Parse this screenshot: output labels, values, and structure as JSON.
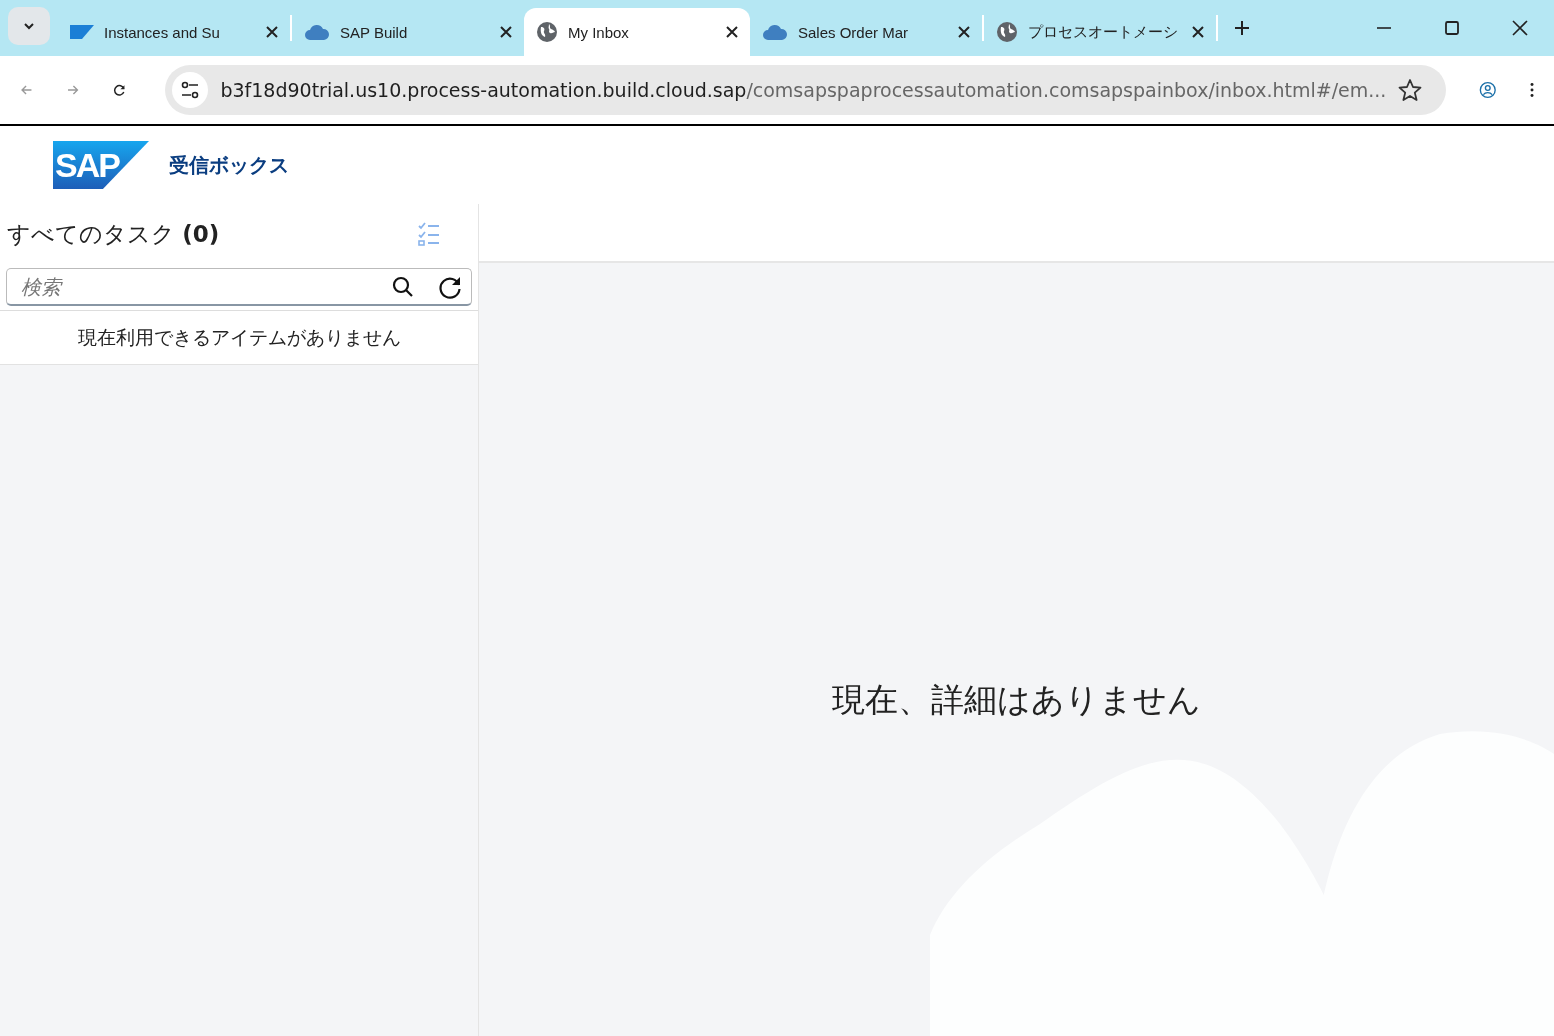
{
  "browser": {
    "tabs": [
      {
        "title": "Instances and Su",
        "kind": "sap",
        "selected": false
      },
      {
        "title": "SAP Build",
        "kind": "cloud",
        "selected": false
      },
      {
        "title": "My Inbox",
        "kind": "globe",
        "selected": true
      },
      {
        "title": "Sales Order Mar",
        "kind": "cloud",
        "selected": false
      },
      {
        "title": "プロセスオートメーシ",
        "kind": "globe",
        "selected": false
      }
    ],
    "address": {
      "host": "b3f18d90trial.us10.process-automation.build.cloud.sap",
      "path": "/comsapspaprocessautomation.comsapspainbox/inbox.html#/em..."
    }
  },
  "app": {
    "logo": "SAP",
    "title": "受信ボックス"
  },
  "list": {
    "heading": "すべてのタスク",
    "count": "(0)",
    "search": {
      "placeholder": "検索"
    },
    "empty_message": "現在利用できるアイテムがありません"
  },
  "detail": {
    "empty_message": "現在、詳細はありません"
  }
}
